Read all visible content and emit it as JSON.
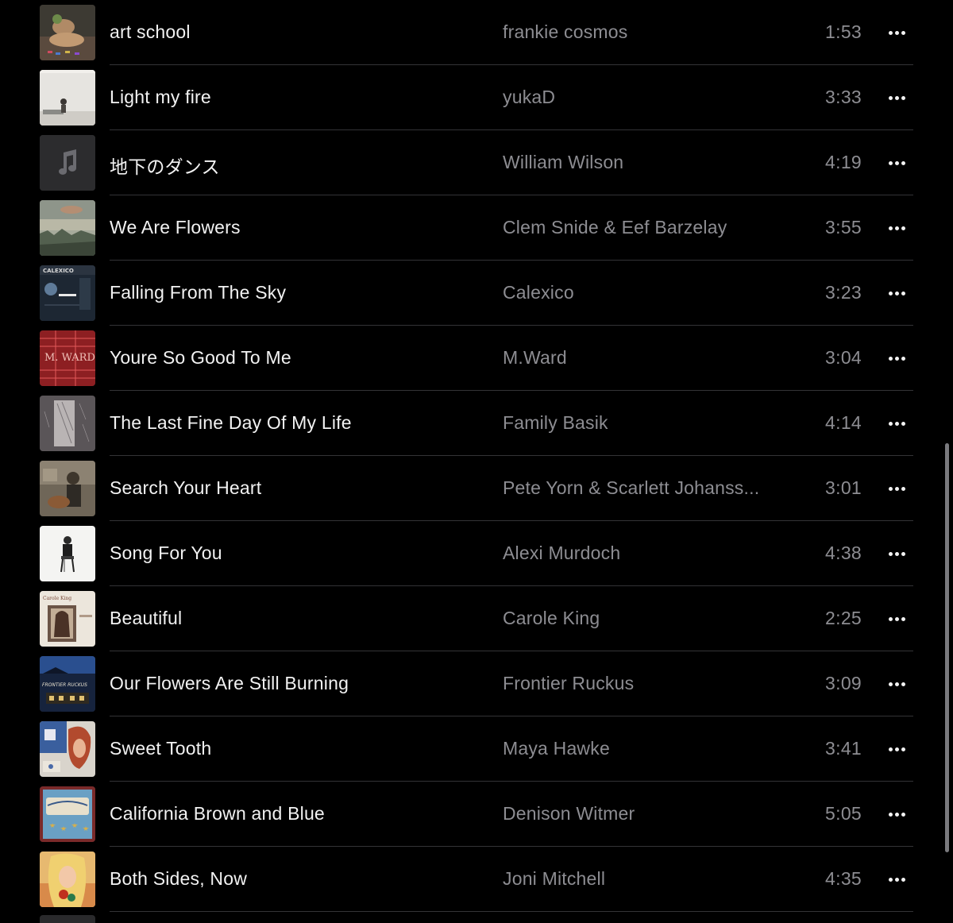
{
  "songs": [
    {
      "title": "art school",
      "artist": "frankie cosmos",
      "duration": "1:53",
      "art": "dog-photo-art"
    },
    {
      "title": "Light my fire",
      "artist": "yukaD",
      "duration": "3:33",
      "art": "white-room-art"
    },
    {
      "title": "地下のダンス",
      "artist": "William Wilson",
      "duration": "4:19",
      "art": "music-note-placeholder-icon"
    },
    {
      "title": "We Are Flowers",
      "artist": "Clem Snide & Eef Barzelay",
      "duration": "3:55",
      "art": "foggy-landscape-art"
    },
    {
      "title": "Falling From The Sky",
      "artist": "Calexico",
      "duration": "3:23",
      "art": "calexico-album-art"
    },
    {
      "title": "Youre So Good To Me",
      "artist": "M.Ward",
      "duration": "3:04",
      "art": "mward-red-neon-art"
    },
    {
      "title": "The Last Fine Day Of My Life",
      "artist": "Family Basik",
      "duration": "4:14",
      "art": "rain-window-art"
    },
    {
      "title": "Search Your Heart",
      "artist": "Pete Yorn & Scarlett Johanss...",
      "duration": "3:01",
      "art": "guitar-photo-art"
    },
    {
      "title": "Song For You",
      "artist": "Alexi Murdoch",
      "duration": "4:38",
      "art": "seated-man-portrait-art"
    },
    {
      "title": "Beautiful",
      "artist": "Carole King",
      "duration": "2:25",
      "art": "carole-king-album-art"
    },
    {
      "title": "Our Flowers Are Still Burning",
      "artist": "Frontier Ruckus",
      "duration": "3:09",
      "art": "frontier-ruckus-night-art"
    },
    {
      "title": "Sweet Tooth",
      "artist": "Maya Hawke",
      "duration": "3:41",
      "art": "collage-art"
    },
    {
      "title": "California Brown and Blue",
      "artist": "Denison Witmer",
      "duration": "5:05",
      "art": "denison-witmer-stars-art"
    },
    {
      "title": "Both Sides, Now",
      "artist": "Joni Mitchell",
      "duration": "4:35",
      "art": "joni-mitchell-portrait-art"
    }
  ],
  "art_texts": {
    "calexico": "CALEXICO",
    "mward": "M. WARD",
    "carole": "Carole King",
    "frontier": "FRONTIER RUCKUS"
  },
  "colors": {
    "background": "#000000",
    "title": "#f2f2f2",
    "secondary": "#8d8d92",
    "separator": "#333336"
  }
}
